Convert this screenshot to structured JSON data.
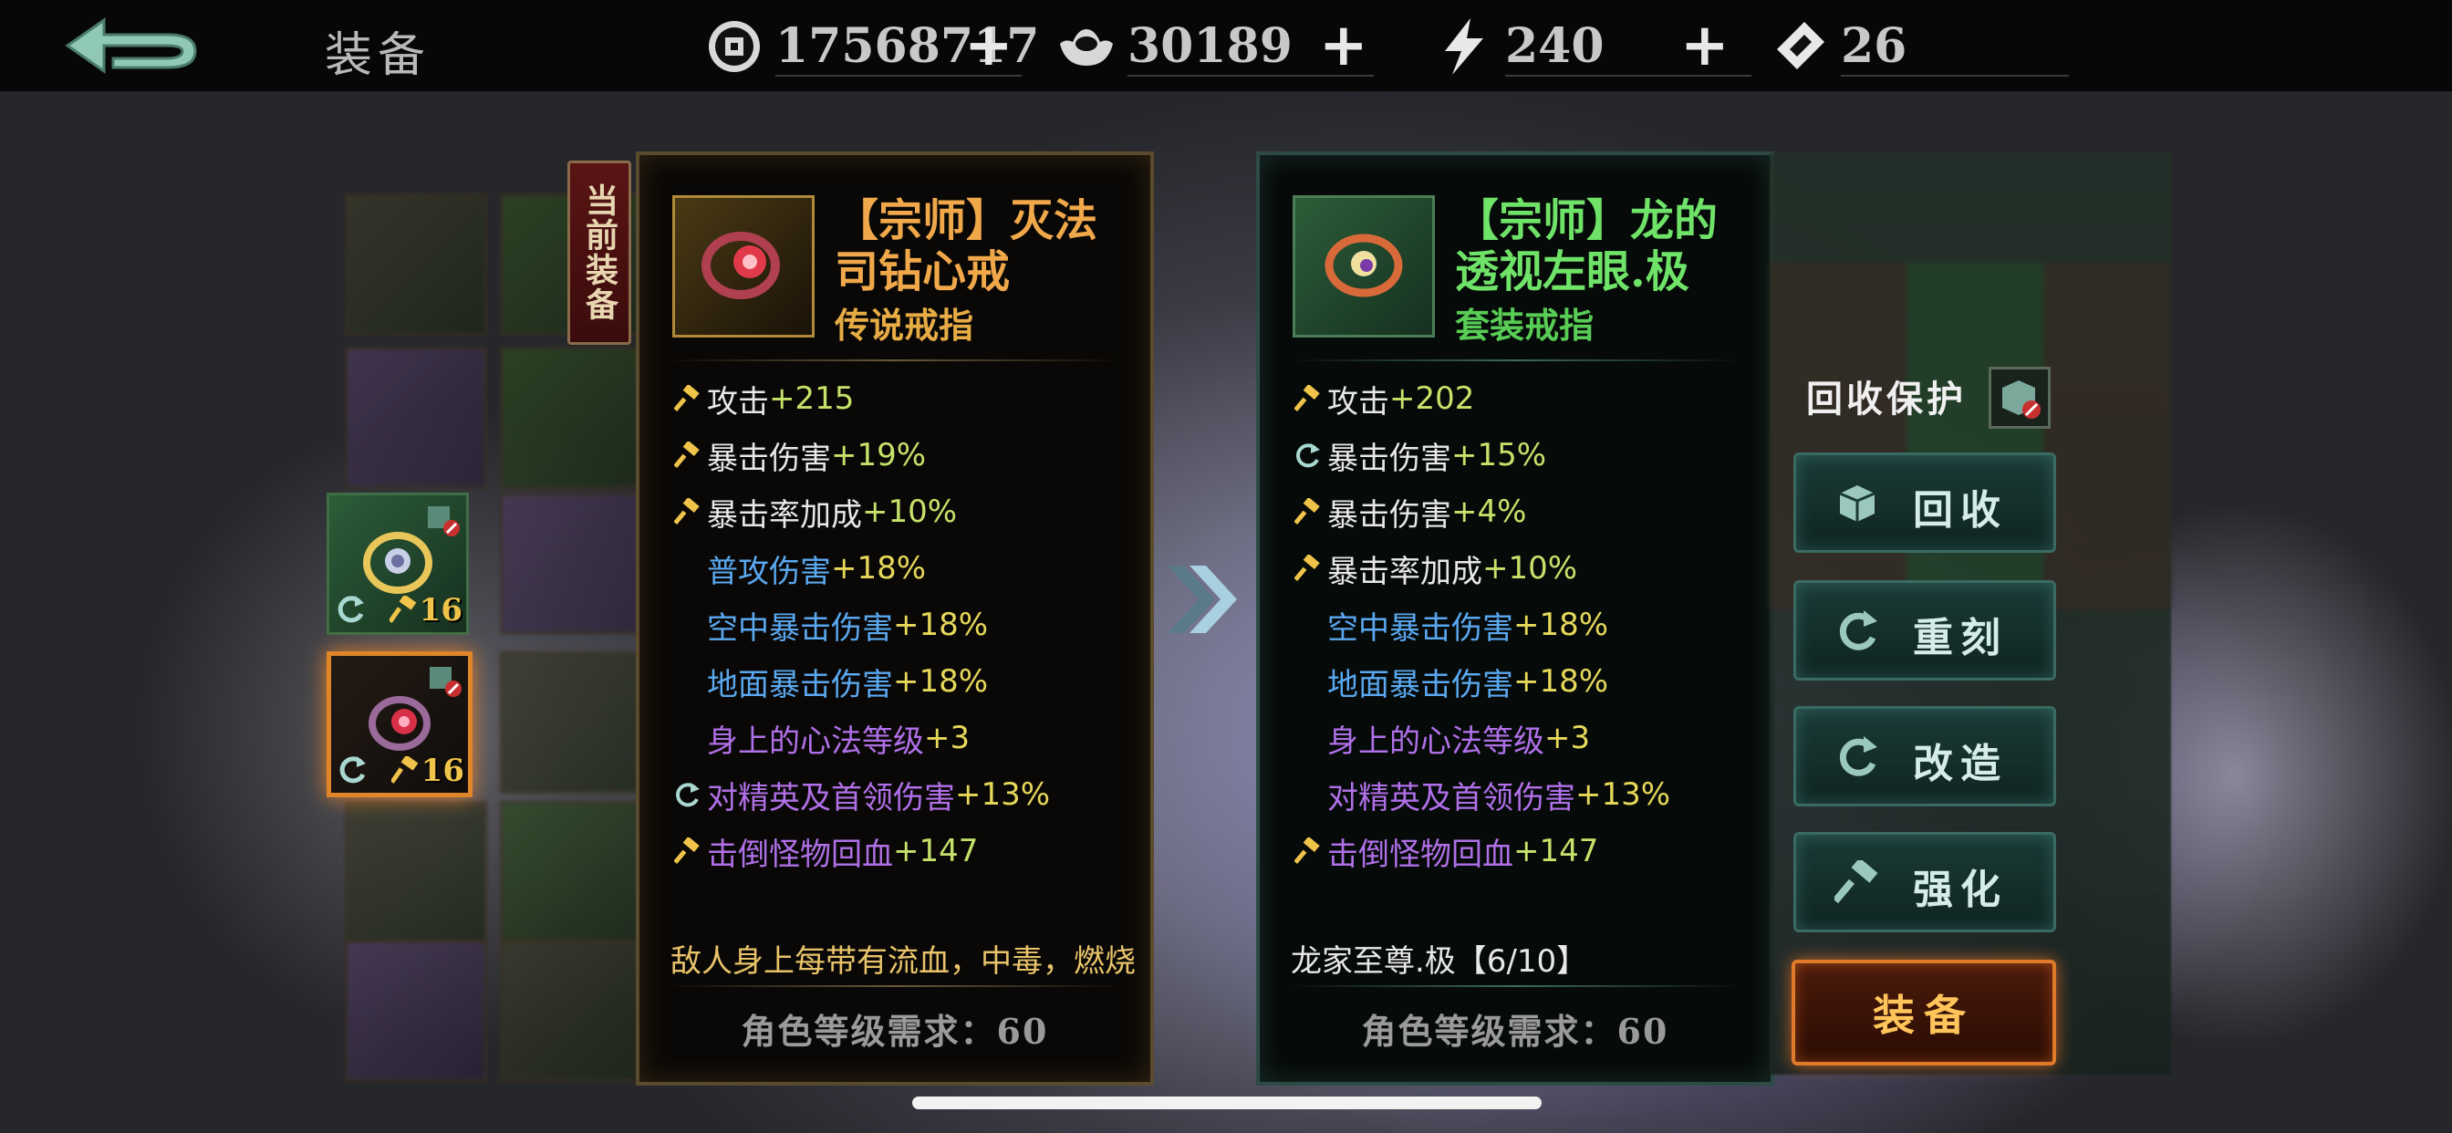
{
  "header": {
    "title": "装备",
    "resources": [
      {
        "icon": "coin-icon",
        "value": "17568717",
        "has_plus": true
      },
      {
        "icon": "silver-ingot-icon",
        "value": "30189",
        "has_plus": true
      },
      {
        "icon": "lightning-icon",
        "value": "240",
        "has_plus": true
      },
      {
        "icon": "ticket-icon",
        "value": "26",
        "has_plus": false
      }
    ]
  },
  "inventory": {
    "selected_items": [
      {
        "icon": "ring-icon",
        "level": "16"
      },
      {
        "icon": "ring-icon",
        "level": "16"
      }
    ]
  },
  "current_tag": "当前装备",
  "current_item": {
    "name": "【宗师】灭法司钻心戒",
    "type": "传说戒指",
    "stats": [
      {
        "icon": "hammer",
        "label": "攻击",
        "value": "+215",
        "label_color": "white",
        "value_color": "green"
      },
      {
        "icon": "hammer",
        "label": "暴击伤害",
        "value": "+19%",
        "label_color": "white",
        "value_color": "green"
      },
      {
        "icon": "hammer",
        "label": "暴击率加成",
        "value": "+10%",
        "label_color": "white",
        "value_color": "green"
      },
      {
        "icon": "",
        "label": "普攻伤害",
        "value": "+18%",
        "label_color": "blue",
        "value_color": "yellow"
      },
      {
        "icon": "",
        "label": "空中暴击伤害",
        "value": "+18%",
        "label_color": "blue",
        "value_color": "yellow"
      },
      {
        "icon": "",
        "label": "地面暴击伤害",
        "value": "+18%",
        "label_color": "blue",
        "value_color": "yellow"
      },
      {
        "icon": "",
        "label": "身上的心法等级",
        "value": "+3",
        "label_color": "purple",
        "value_color": "yellow"
      },
      {
        "icon": "refresh",
        "label": "对精英及首领伤害",
        "value": "+13%",
        "label_color": "purple",
        "value_color": "yellow"
      },
      {
        "icon": "hammer",
        "label": "击倒怪物回血",
        "value": "+147",
        "label_color": "purple",
        "value_color": "green"
      }
    ],
    "description": "敌人身上每带有流血，中毒，燃烧",
    "requirement": "角色等级需求：60"
  },
  "compare_item": {
    "name": "【宗师】龙的透视左眼.极",
    "type": "套装戒指",
    "stats": [
      {
        "icon": "hammer",
        "label": "攻击",
        "value": "+202",
        "label_color": "white",
        "value_color": "green"
      },
      {
        "icon": "refresh",
        "label": "暴击伤害",
        "value": "+15%",
        "label_color": "white",
        "value_color": "green"
      },
      {
        "icon": "hammer",
        "label": "暴击伤害",
        "value": "+4%",
        "label_color": "white",
        "value_color": "green"
      },
      {
        "icon": "hammer",
        "label": "暴击率加成",
        "value": "+10%",
        "label_color": "white",
        "value_color": "green"
      },
      {
        "icon": "",
        "label": "空中暴击伤害",
        "value": "+18%",
        "label_color": "blue",
        "value_color": "yellow"
      },
      {
        "icon": "",
        "label": "地面暴击伤害",
        "value": "+18%",
        "label_color": "blue",
        "value_color": "yellow"
      },
      {
        "icon": "",
        "label": "身上的心法等级",
        "value": "+3",
        "label_color": "purple",
        "value_color": "yellow"
      },
      {
        "icon": "",
        "label": "对精英及首领伤害",
        "value": "+13%",
        "label_color": "purple",
        "value_color": "yellow"
      },
      {
        "icon": "hammer",
        "label": "击倒怪物回血",
        "value": "+147",
        "label_color": "purple",
        "value_color": "green"
      }
    ],
    "set_info": "龙家至尊.极【6/10】",
    "requirement": "角色等级需求：60"
  },
  "actions": {
    "protect_label": "回收保护",
    "buttons": [
      {
        "id": "recycle",
        "label": "回收",
        "icon": "cube-icon"
      },
      {
        "id": "reforge",
        "label": "重刻",
        "icon": "refresh-icon"
      },
      {
        "id": "modify",
        "label": "改造",
        "icon": "refresh-icon"
      },
      {
        "id": "enhance",
        "label": "强化",
        "icon": "hammer-icon"
      }
    ],
    "equip_label": "装备"
  },
  "colors": {
    "legend_orange": "#f0a84a",
    "set_green": "#6fe268",
    "stat_white": "#e8e8e8",
    "stat_blue": "#5aa8f0",
    "stat_purple": "#b070e8",
    "value_green": "#c6e26a",
    "value_yellow": "#e6d85a",
    "equip_orange": "#e07a2a"
  }
}
